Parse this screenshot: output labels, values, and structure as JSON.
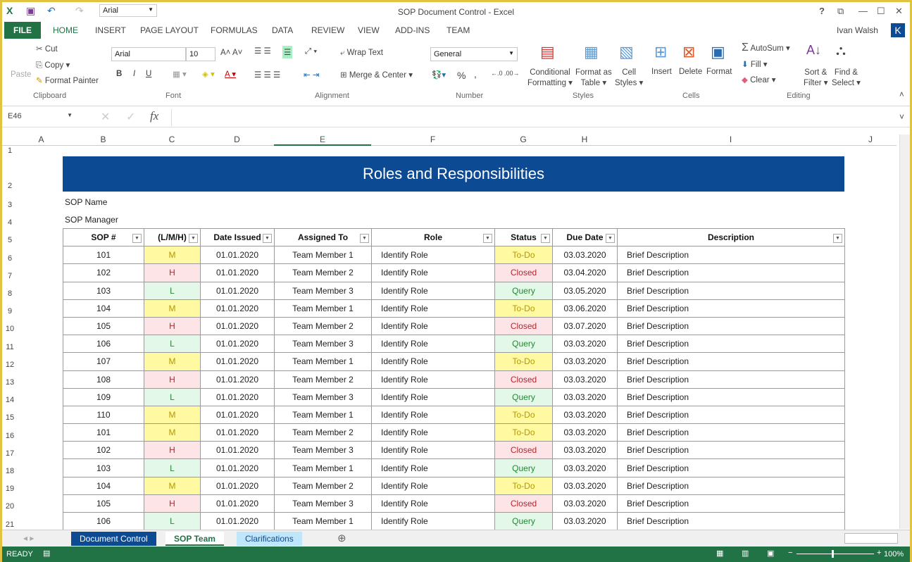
{
  "app": {
    "title": "SOP Document Control - Excel",
    "qa_font": "Arial",
    "user": "Ivan Walsh",
    "avatar": "K"
  },
  "tabs": [
    "FILE",
    "HOME",
    "INSERT",
    "PAGE LAYOUT",
    "FORMULAS",
    "DATA",
    "REVIEW",
    "VIEW",
    "ADD-INS",
    "TEAM"
  ],
  "ribbon": {
    "clipboard": {
      "paste": "Paste",
      "cut": "Cut",
      "copy": "Copy",
      "format_painter": "Format Painter",
      "group": "Clipboard"
    },
    "font": {
      "name": "Arial",
      "size": "10",
      "bold": "B",
      "italic": "I",
      "underline": "U",
      "group": "Font"
    },
    "alignment": {
      "wrap": "Wrap Text",
      "merge": "Merge & Center",
      "group": "Alignment"
    },
    "number": {
      "format": "General",
      "percent": "%",
      "comma": ",",
      "group": "Number"
    },
    "styles": {
      "cond1": "Conditional",
      "cond2": "Formatting",
      "fmt1": "Format as",
      "fmt2": "Table",
      "cell1": "Cell",
      "cell2": "Styles",
      "group": "Styles"
    },
    "cells": {
      "insert": "Insert",
      "delete": "Delete",
      "format": "Format",
      "group": "Cells"
    },
    "editing": {
      "autosum": "AutoSum",
      "fill": "Fill",
      "clear": "Clear",
      "sort1": "Sort &",
      "sort2": "Filter",
      "find1": "Find &",
      "find2": "Select",
      "group": "Editing"
    }
  },
  "formula_bar": {
    "name_box": "E46",
    "fx": "fx",
    "value": ""
  },
  "columns": [
    "A",
    "B",
    "C",
    "D",
    "E",
    "F",
    "G",
    "H",
    "I",
    "J"
  ],
  "selected_column": "E",
  "rows": [
    "1",
    "2",
    "3",
    "4",
    "5",
    "6",
    "7",
    "8",
    "9",
    "10",
    "11",
    "12",
    "13",
    "14",
    "15",
    "16",
    "17",
    "18",
    "19",
    "20",
    "21"
  ],
  "sheet": {
    "title": "Roles and Responsibilities",
    "sop_name_label": "SOP Name",
    "sop_manager_label": "SOP Manager",
    "headers": [
      "SOP #",
      "(L/M/H)",
      "Date Issued",
      "Assigned To",
      "Role",
      "Status",
      "Due Date",
      "Description"
    ],
    "data": [
      [
        "101",
        "M",
        "01.01.2020",
        "Team Member 1",
        "Identify Role",
        "To-Do",
        "03.03.2020",
        "Brief Description"
      ],
      [
        "102",
        "H",
        "01.01.2020",
        "Team Member 2",
        "Identify Role",
        "Closed",
        "03.04.2020",
        "Brief Description"
      ],
      [
        "103",
        "L",
        "01.01.2020",
        "Team Member 3",
        "Identify Role",
        "Query",
        "03.05.2020",
        "Brief Description"
      ],
      [
        "104",
        "M",
        "01.01.2020",
        "Team Member 1",
        "Identify Role",
        "To-Do",
        "03.06.2020",
        "Brief Description"
      ],
      [
        "105",
        "H",
        "01.01.2020",
        "Team Member 2",
        "Identify Role",
        "Closed",
        "03.07.2020",
        "Brief Description"
      ],
      [
        "106",
        "L",
        "01.01.2020",
        "Team Member 3",
        "Identify Role",
        "Query",
        "03.03.2020",
        "Brief Description"
      ],
      [
        "107",
        "M",
        "01.01.2020",
        "Team Member 1",
        "Identify Role",
        "To-Do",
        "03.03.2020",
        "Brief Description"
      ],
      [
        "108",
        "H",
        "01.01.2020",
        "Team Member 2",
        "Identify Role",
        "Closed",
        "03.03.2020",
        "Brief Description"
      ],
      [
        "109",
        "L",
        "01.01.2020",
        "Team Member 3",
        "Identify Role",
        "Query",
        "03.03.2020",
        "Brief Description"
      ],
      [
        "110",
        "M",
        "01.01.2020",
        "Team Member 1",
        "Identify Role",
        "To-Do",
        "03.03.2020",
        "Brief Description"
      ],
      [
        "101",
        "M",
        "01.01.2020",
        "Team Member 2",
        "Identify Role",
        "To-Do",
        "03.03.2020",
        "Brief Description"
      ],
      [
        "102",
        "H",
        "01.01.2020",
        "Team Member 3",
        "Identify Role",
        "Closed",
        "03.03.2020",
        "Brief Description"
      ],
      [
        "103",
        "L",
        "01.01.2020",
        "Team Member 1",
        "Identify Role",
        "Query",
        "03.03.2020",
        "Brief Description"
      ],
      [
        "104",
        "M",
        "01.01.2020",
        "Team Member 2",
        "Identify Role",
        "To-Do",
        "03.03.2020",
        "Brief Description"
      ],
      [
        "105",
        "H",
        "01.01.2020",
        "Team Member 3",
        "Identify Role",
        "Closed",
        "03.03.2020",
        "Brief Description"
      ],
      [
        "106",
        "L",
        "01.01.2020",
        "Team Member 1",
        "Identify Role",
        "Query",
        "03.03.2020",
        "Brief Description"
      ]
    ]
  },
  "sheet_tabs": [
    "Document Control",
    "SOP Team",
    "Clarifications"
  ],
  "active_sheet": "SOP Team",
  "status": {
    "ready": "READY",
    "zoom": "100%"
  },
  "colors": {
    "excel_green": "#217346",
    "banner": "#0c4a94",
    "high": "#fde4e6",
    "medium": "#fff9a1",
    "low": "#e4f8e9"
  }
}
